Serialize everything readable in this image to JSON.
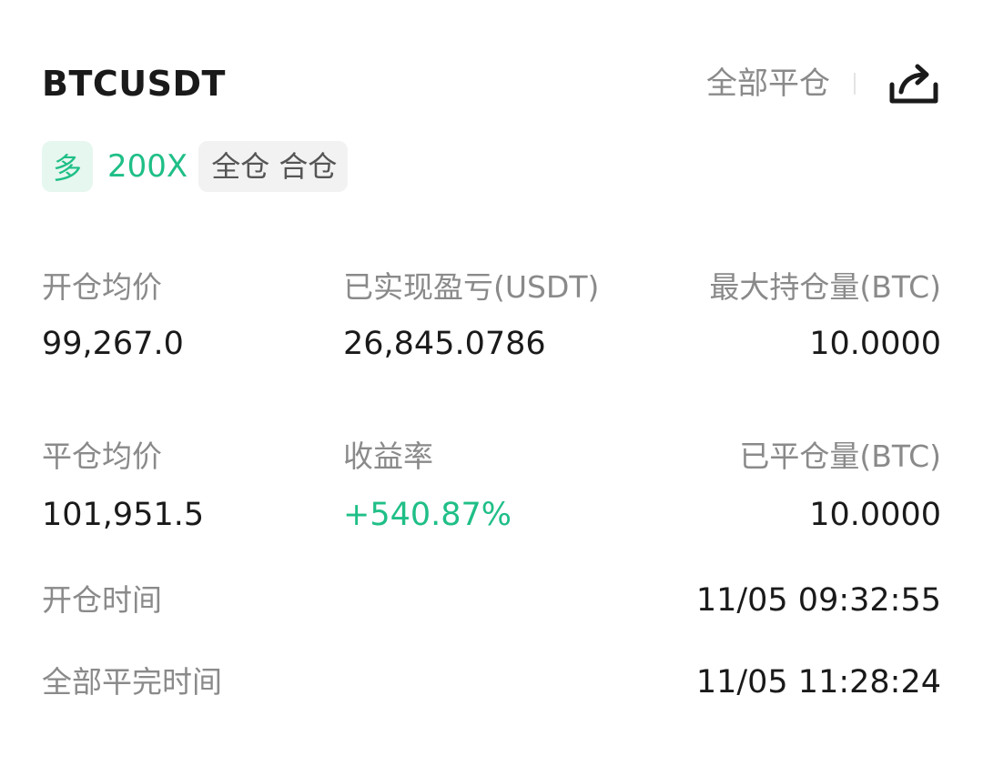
{
  "header": {
    "symbol": "BTCUSDT",
    "close_all_label": "全部平仓",
    "share_icon": "share-icon"
  },
  "tags": {
    "side": "多",
    "leverage": "200X",
    "margin_mode": "全仓 合仓"
  },
  "stats": {
    "open_avg_price": {
      "label": "开仓均价",
      "value": "99,267.0"
    },
    "realized_pnl": {
      "label": "已实现盈亏(USDT)",
      "value": "26,845.0786"
    },
    "max_position": {
      "label": "最大持仓量(BTC)",
      "value": "10.0000"
    },
    "close_avg_price": {
      "label": "平仓均价",
      "value": "101,951.5"
    },
    "roi": {
      "label": "收益率",
      "value": "+540.87%"
    },
    "closed_amount": {
      "label": "已平仓量(BTC)",
      "value": "10.0000"
    },
    "open_time": {
      "label": "开仓时间",
      "value": "11/05 09:32:55"
    },
    "close_time": {
      "label": "全部平完时间",
      "value": "11/05 11:28:24"
    }
  },
  "colors": {
    "accent_green": "#1fbf87",
    "label_gray": "#8a8a8a",
    "text_dark": "#1a1a1a"
  }
}
